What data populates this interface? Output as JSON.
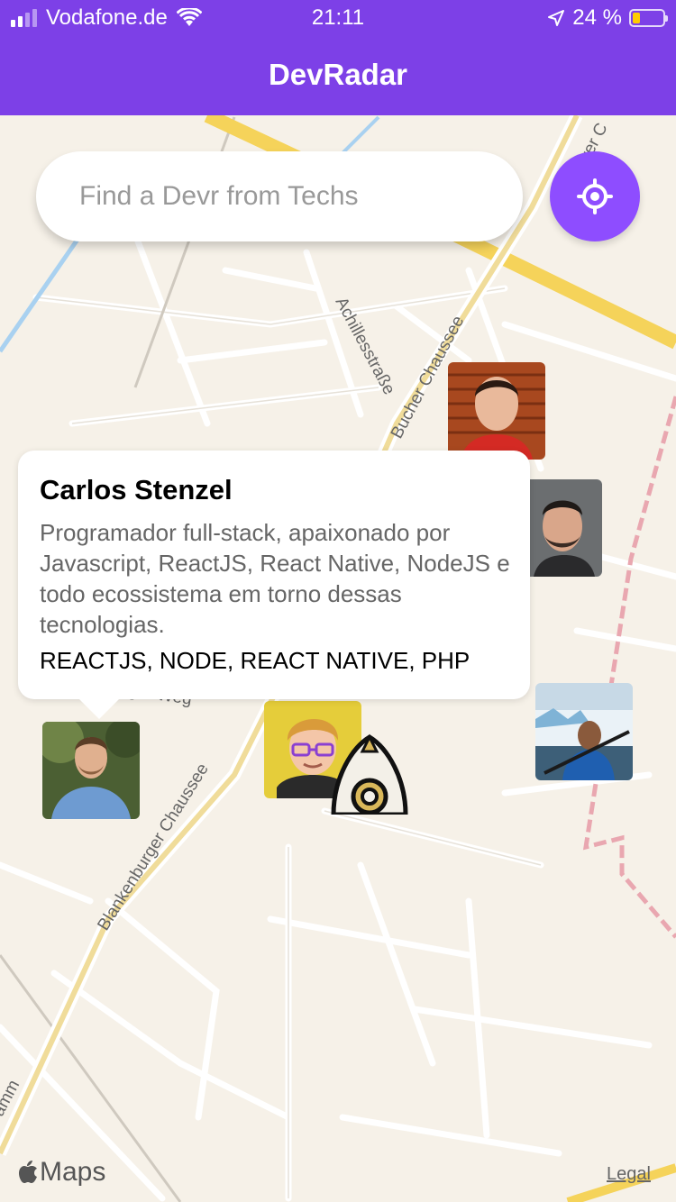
{
  "status_bar": {
    "carrier": "Vodafone.de",
    "time": "21:11",
    "battery_percent": "24 %",
    "battery_level": 0.24,
    "icons": [
      "signal-icon",
      "wifi-icon",
      "location-arrow-icon",
      "battery-icon"
    ]
  },
  "header": {
    "title": "DevRadar"
  },
  "search": {
    "placeholder": "Find a Devr from Techs"
  },
  "locate_button": {
    "icon": "crosshair-icon"
  },
  "map": {
    "street_labels": [
      "Achillesstraße",
      "Bucher Chaussee",
      "Blankenburger Chaussee",
      "Schräger Weg",
      "Karower C",
      "amm"
    ],
    "attribution": "Maps",
    "legal": "Legal"
  },
  "callout": {
    "name": "Carlos Stenzel",
    "bio": "Programador full-stack, apaixonado por Javascript, ReactJS, React Native, NodeJS e todo ecossistema em torno dessas tecnologias.",
    "techs": "REACTJS, NODE, REACT NATIVE, PHP"
  },
  "colors": {
    "primary": "#7d40e7",
    "button": "#8e4dff",
    "map_bg": "#f6f1e8",
    "road_main": "#f5d35a"
  }
}
